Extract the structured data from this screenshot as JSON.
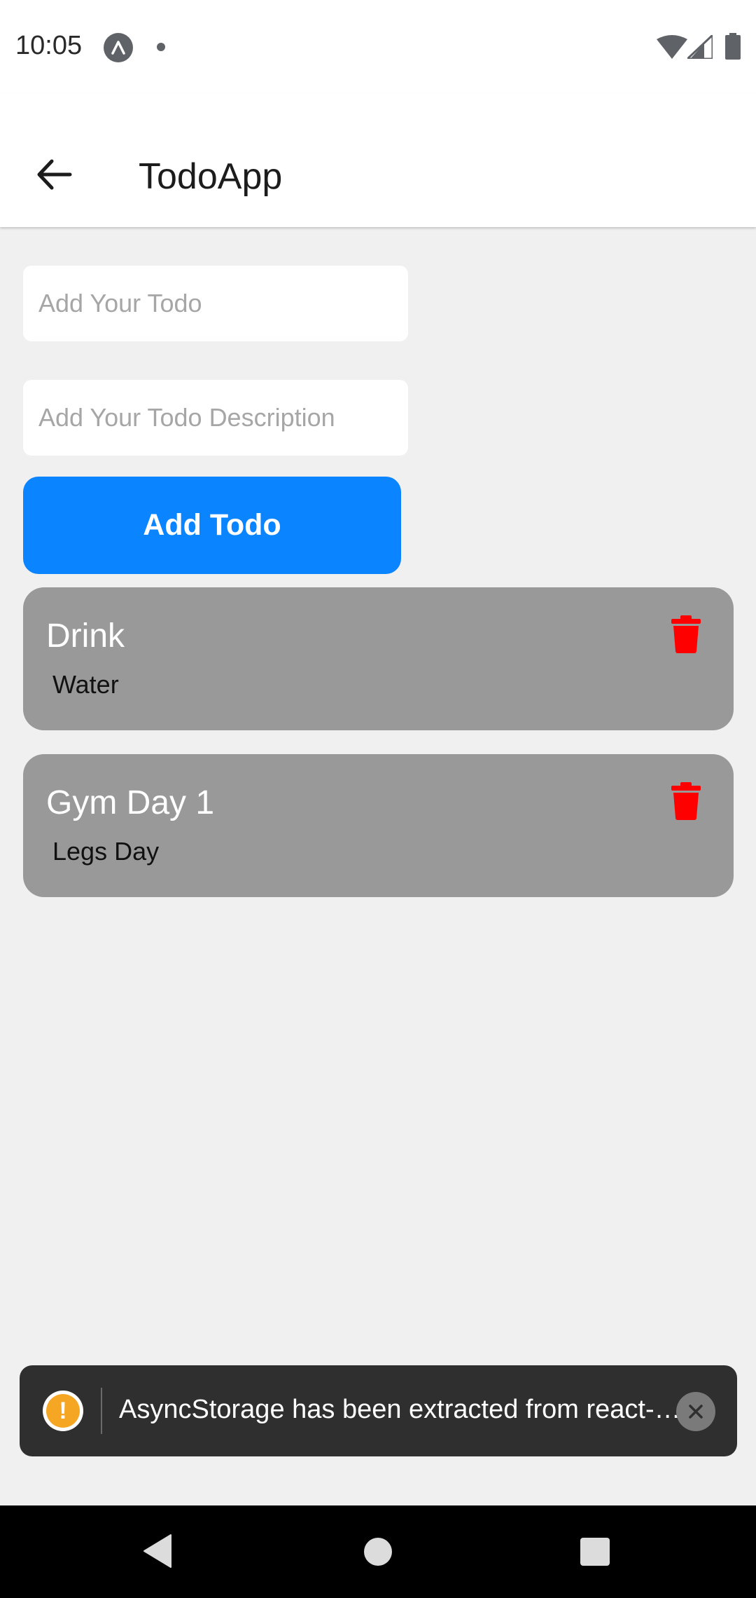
{
  "status_bar": {
    "time": "10:05",
    "icons": [
      "expo-icon",
      "notification-dot-icon",
      "wifi-icon",
      "signal-icon",
      "battery-icon"
    ]
  },
  "header": {
    "back_icon": "back-arrow-icon",
    "title": "TodoApp"
  },
  "form": {
    "title_placeholder": "Add Your Todo",
    "title_value": "",
    "description_placeholder": "Add Your Todo Description",
    "description_value": "",
    "add_button_label": "Add Todo"
  },
  "todos": [
    {
      "title": "Drink",
      "description": "Water",
      "action_icon": "trash-icon"
    },
    {
      "title": "Gym Day 1",
      "description": "Legs Day",
      "action_icon": "trash-icon"
    }
  ],
  "toast": {
    "icon": "warning-icon",
    "text": "AsyncStorage has been extracted from react-native core and will be removed in a future release.",
    "close_icon": "close-icon"
  },
  "nav_bar": {
    "icons": [
      "nav-back-icon",
      "nav-home-icon",
      "nav-recents-icon"
    ]
  },
  "colors": {
    "accent": "#0a84ff",
    "card": "#999999",
    "delete": "#ff0000",
    "toast_background": "#2f2f2f",
    "warning": "#f5a623"
  }
}
